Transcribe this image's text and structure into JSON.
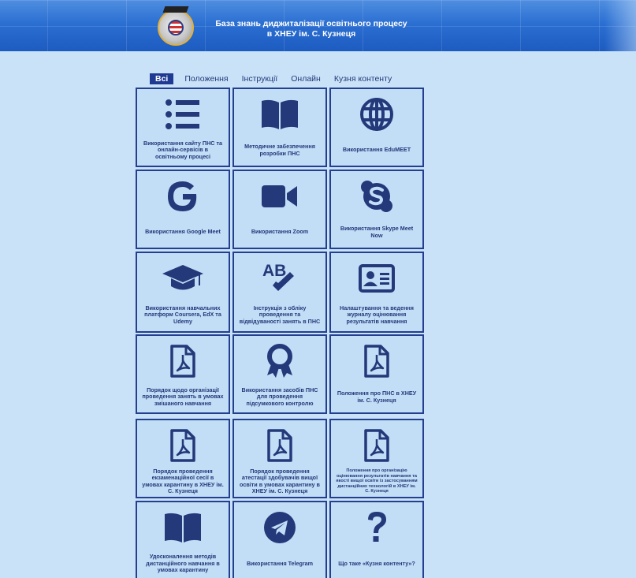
{
  "header": {
    "title": "База знань диджиталізації освітнього процесу в ХНЕУ ім. С. Кузнеця"
  },
  "filters": [
    {
      "label": "Всі",
      "active": true
    },
    {
      "label": "Положення",
      "active": false
    },
    {
      "label": "Інструкції",
      "active": false
    },
    {
      "label": "Онлайн",
      "active": false
    },
    {
      "label": "Кузня контенту",
      "active": false
    }
  ],
  "cards": [
    {
      "label": "Використання сайту ПНС та онлайн-сервісів в освітньому процесі",
      "icon": "list-icon"
    },
    {
      "label": "Методичне забезпечення розробки ПНС",
      "icon": "book-open-icon"
    },
    {
      "label": "Використання EduMEET",
      "icon": "globe-icon"
    },
    {
      "label": "Використання Google Meet",
      "icon": "google-icon"
    },
    {
      "label": "Використання Zoom",
      "icon": "video-camera-icon"
    },
    {
      "label": "Використання Skype Meet Now",
      "icon": "skype-icon"
    },
    {
      "label": "Використання навчальних платформ Coursera, EdX та Udemy",
      "icon": "graduation-cap-icon"
    },
    {
      "label": "Інструкція з обліку проведення та відвідуваності занять в ПНС",
      "icon": "spell-check-icon"
    },
    {
      "label": "Налаштування та ведення журналу оцінювання результатів навчання",
      "icon": "id-card-icon"
    },
    {
      "label": "Порядок щодо організації проведення занять в умовах змішаного навчання",
      "icon": "pdf-file-icon"
    },
    {
      "label": "Використання засобів ПНС для проведення підсумкового контролю",
      "icon": "award-icon"
    },
    {
      "label": "Положення про ПНС в ХНЕУ ім. С. Кузнеця",
      "icon": "pdf-file-icon"
    },
    {
      "label": "Порядок проведення екзаменаційної сесії в умовах карантину в ХНЕУ ім. С. Кузнеця",
      "icon": "pdf-file-icon"
    },
    {
      "label": "Порядок проведення атестації здобувачів вищої освіти в умовах карантину в ХНЕУ ім. С. Кузнеця",
      "icon": "pdf-file-icon"
    },
    {
      "label": "Положення про організацію оцінювання результатів навчання та якості вищої освіти із застосуванням дистанційних технологій в ХНЕУ ім. С. Кузнеця",
      "icon": "pdf-file-icon"
    },
    {
      "label": "Удосконалення методів дистанційного навчання в умовах карантину",
      "icon": "book-open-icon"
    },
    {
      "label": "Використання Telegram",
      "icon": "telegram-icon"
    },
    {
      "label": "Що таке «Кузня контенту»?",
      "icon": "question-icon"
    }
  ],
  "colors": {
    "background": "#c9e2f8",
    "accent": "#1f3a93",
    "header": "#2b6fd2"
  }
}
